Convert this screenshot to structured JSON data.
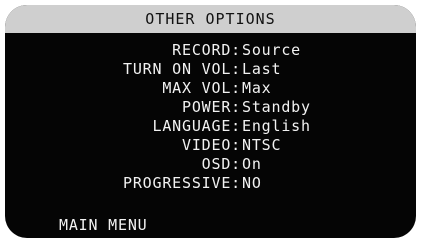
{
  "header": {
    "title": "OTHER OPTIONS"
  },
  "options": [
    {
      "label": "RECORD:",
      "value": "Source"
    },
    {
      "label": "TURN ON VOL:",
      "value": "Last"
    },
    {
      "label": "MAX VOL:",
      "value": "Max"
    },
    {
      "label": "POWER:",
      "value": "Standby"
    },
    {
      "label": "LANGUAGE:",
      "value": "English"
    },
    {
      "label": "VIDEO:",
      "value": "NTSC"
    },
    {
      "label": "OSD:",
      "value": "On"
    },
    {
      "label": "PROGRESSIVE:",
      "value": "NO"
    }
  ],
  "footer": {
    "main_menu_label": "MAIN MENU"
  }
}
